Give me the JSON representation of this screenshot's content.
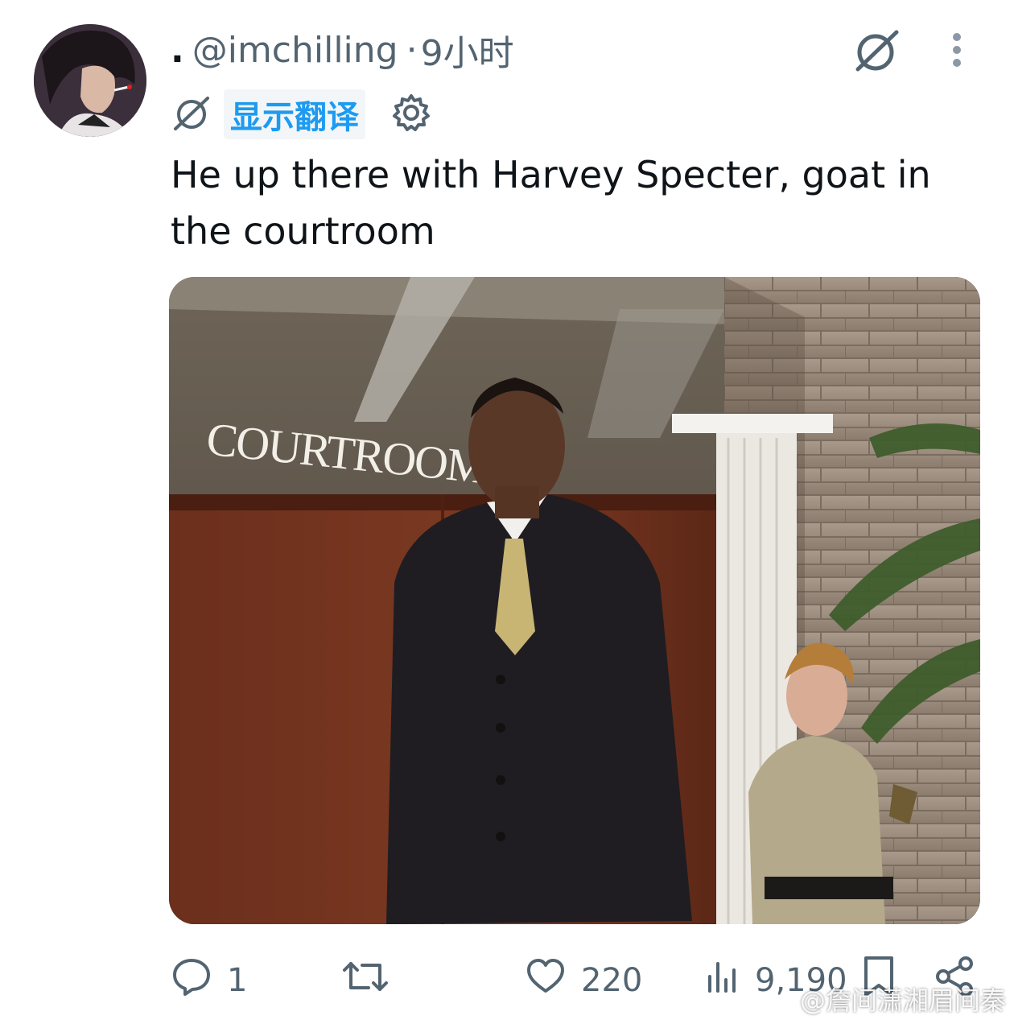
{
  "tweet": {
    "prefix_dot": ".",
    "handle": "@imchilling",
    "separator": "·",
    "time": "9小时",
    "translate_label": "显示翻译",
    "text": "He up there with Harvey Specter, goat in the courtroom",
    "media_sign_text": "COURTROOM"
  },
  "actions": {
    "reply_count": "1",
    "repost_count": "",
    "like_count": "220",
    "views_count": "9,190"
  },
  "watermark": "@詹间潇湘眉间秦",
  "icons": [
    "avatar",
    "grok-icon",
    "more-icon",
    "settings-gear-icon",
    "reply-icon",
    "repost-icon",
    "like-icon",
    "views-icon",
    "bookmark-icon",
    "share-icon"
  ],
  "colors": {
    "accent": "#1d9bf0",
    "secondary_text": "#536471",
    "primary_text": "#0f1419"
  }
}
